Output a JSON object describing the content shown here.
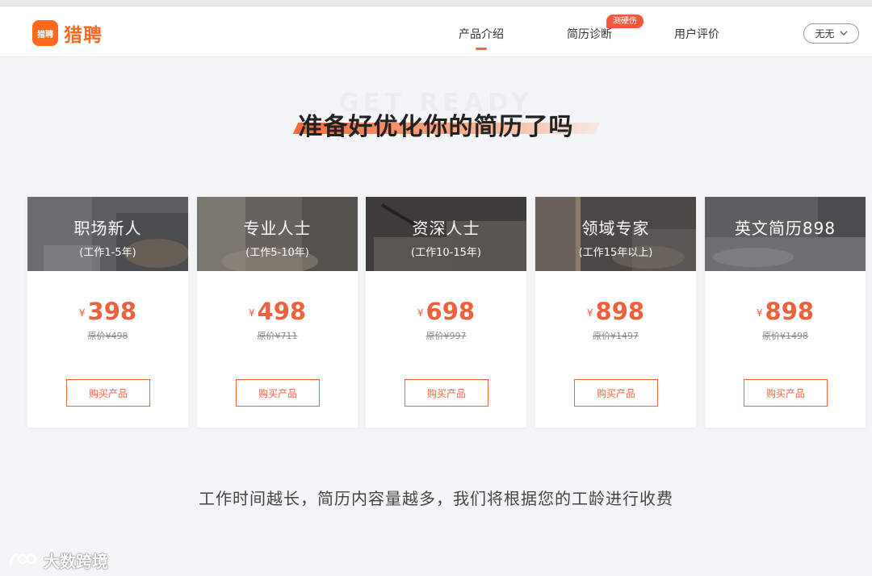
{
  "header": {
    "logo_icon_text": "猎聘",
    "logo_text": "猎聘",
    "nav": [
      {
        "label": "产品介绍",
        "active": true
      },
      {
        "label": "简历诊断",
        "badge": "测硬伤"
      },
      {
        "label": "用户评价"
      }
    ],
    "user_name": "无无"
  },
  "section": {
    "bg_text": "GET READY",
    "title": "准备好优化你的简历了吗"
  },
  "cards": [
    {
      "name": "职场新人",
      "years": "(工作1-5年)",
      "currency": "¥",
      "price": "398",
      "original": "原价¥498",
      "button": "购买产品"
    },
    {
      "name": "专业人士",
      "years": "(工作5-10年)",
      "currency": "¥",
      "price": "498",
      "original": "原价¥711",
      "button": "购买产品"
    },
    {
      "name": "资深人士",
      "years": "(工作10-15年)",
      "currency": "¥",
      "price": "698",
      "original": "原价¥997",
      "button": "购买产品"
    },
    {
      "name": "领域专家",
      "years": "(工作15年以上)",
      "currency": "¥",
      "price": "898",
      "original": "原价¥1497",
      "button": "购买产品"
    },
    {
      "name": "英文简历898",
      "years": "",
      "currency": "¥",
      "price": "898",
      "original": "原价¥1498",
      "button": "购买产品"
    }
  ],
  "footnote": "工作时间越长，简历内容量越多，我们将根据您的工龄进行收费",
  "watermark": {
    "text": "大数跨境"
  },
  "colors": {
    "accent": "#f0603a",
    "brand": "#ff6a1e"
  }
}
